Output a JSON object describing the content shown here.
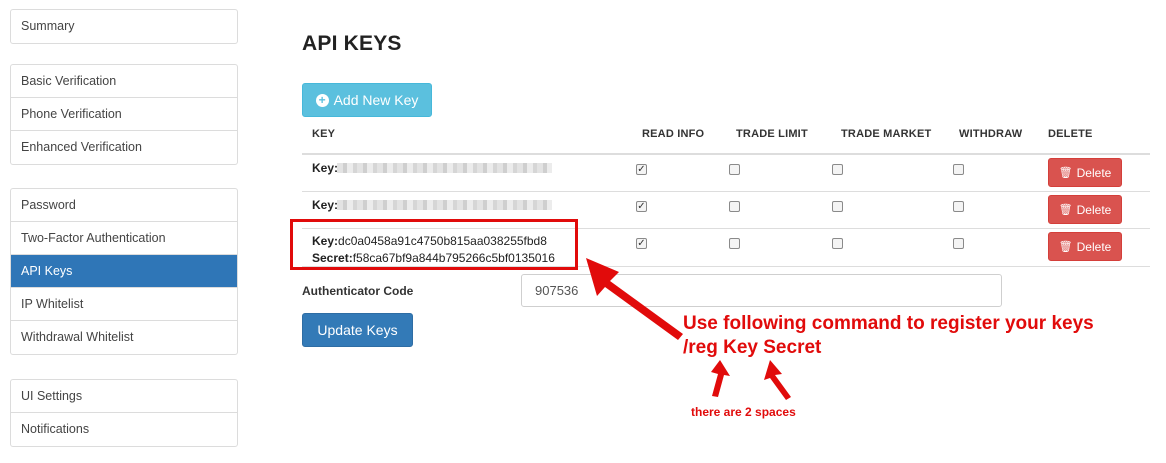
{
  "sidebar": {
    "groups": [
      [
        "Summary"
      ],
      [
        "Basic Verification",
        "Phone Verification",
        "Enhanced Verification"
      ],
      [
        "Password",
        "Two-Factor Authentication",
        "API Keys",
        "IP Whitelist",
        "Withdrawal Whitelist"
      ],
      [
        "UI Settings",
        "Notifications"
      ]
    ],
    "active_item": "API Keys"
  },
  "main": {
    "title": "API KEYS",
    "add_button_label": "Add New Key",
    "table": {
      "headers": [
        "KEY",
        "READ INFO",
        "TRADE LIMIT",
        "TRADE MARKET",
        "WITHDRAW",
        "DELETE"
      ],
      "rows": [
        {
          "key_label": "Key:",
          "key_value": "",
          "secret_label": "",
          "secret_value": "",
          "read_info": true,
          "trade_limit": false,
          "trade_market": false,
          "withdraw": false,
          "delete_label": "Delete"
        },
        {
          "key_label": "Key:",
          "key_value": "",
          "secret_label": "",
          "secret_value": "",
          "read_info": true,
          "trade_limit": false,
          "trade_market": false,
          "withdraw": false,
          "delete_label": "Delete"
        },
        {
          "key_label": "Key:",
          "key_value": "dc0a0458a91c4750b815aa038255fbd8",
          "secret_label": "Secret:",
          "secret_value": "f58ca67bf9a844b795266c5bf0135016",
          "read_info": true,
          "trade_limit": false,
          "trade_market": false,
          "withdraw": false,
          "delete_label": "Delete"
        }
      ]
    },
    "auth_label": "Authenticator Code",
    "auth_value": "907536",
    "update_button_label": "Update Keys"
  },
  "annotation": {
    "line1": "Use following command to register your keys",
    "line2": "/reg Key Secret",
    "note": "there are 2 spaces",
    "color": "#e10b0b"
  },
  "icons": {
    "add": "plus-circle-icon",
    "delete": "trash-icon",
    "arrow": "red-arrow"
  }
}
